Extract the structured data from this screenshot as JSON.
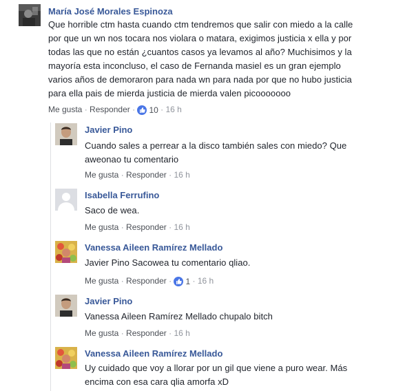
{
  "comments": [
    {
      "author": "María José Morales Espinoza",
      "lines": [
        "Que horrible ctm hasta cuando ctm tendremos que salir con miedo a la calle",
        "por que un wn nos tocara nos violara o matara, exigimos justicia x ella y por",
        "todas las que no están ¿cuantos casos ya levamos al año? Muchisimos y la",
        "mayoría esta inconcluso, el caso de Fernanda masiel es un gran ejemplo",
        "varios años de demoraron para nada wn para nada por que no hubo justicia",
        "para ella pais de mierda justicia de mierda valen picooooooo"
      ],
      "like_label": "Me gusta",
      "reply_label": "Responder",
      "reaction_count": "10",
      "time": "16 h",
      "avatar_icon": "profile-photo-dark"
    }
  ],
  "replies": [
    {
      "author": "Javier Pino",
      "lines": [
        "Cuando sales a perrear a la disco también sales con miedo? Que",
        "aweonao tu comentario"
      ],
      "like_label": "Me gusta",
      "reply_label": "Responder",
      "reaction_count": "",
      "time": "16 h",
      "avatar_icon": "profile-photo-man"
    },
    {
      "author": "Isabella Ferrufino",
      "lines": [
        "Saco de wea."
      ],
      "like_label": "Me gusta",
      "reply_label": "Responder",
      "reaction_count": "",
      "time": "16 h",
      "avatar_icon": "default-profile-silhouette"
    },
    {
      "author": "Vanessa Aileen Ramírez Mellado",
      "lines": [
        "Javier Pino Sacowea tu comentario qliao."
      ],
      "like_label": "Me gusta",
      "reply_label": "Responder",
      "reaction_count": "1",
      "time": "16 h",
      "avatar_icon": "profile-photo-colorful"
    },
    {
      "author": "Javier Pino",
      "lines": [
        "Vanessa Aileen Ramírez Mellado chupalo bitch"
      ],
      "like_label": "Me gusta",
      "reply_label": "Responder",
      "reaction_count": "",
      "time": "16 h",
      "avatar_icon": "profile-photo-man"
    },
    {
      "author": "Vanessa Aileen Ramírez Mellado",
      "lines": [
        "Uy cuidado que voy a llorar por un gil que viene a puro wear. Más",
        "encima con esa cara qlia amorfa xD"
      ],
      "avatar_icon": "profile-photo-colorful"
    }
  ],
  "colors": {
    "author": "#385898",
    "meta": "#90949c",
    "like_blue": "#4a76e6"
  },
  "separator": "·"
}
